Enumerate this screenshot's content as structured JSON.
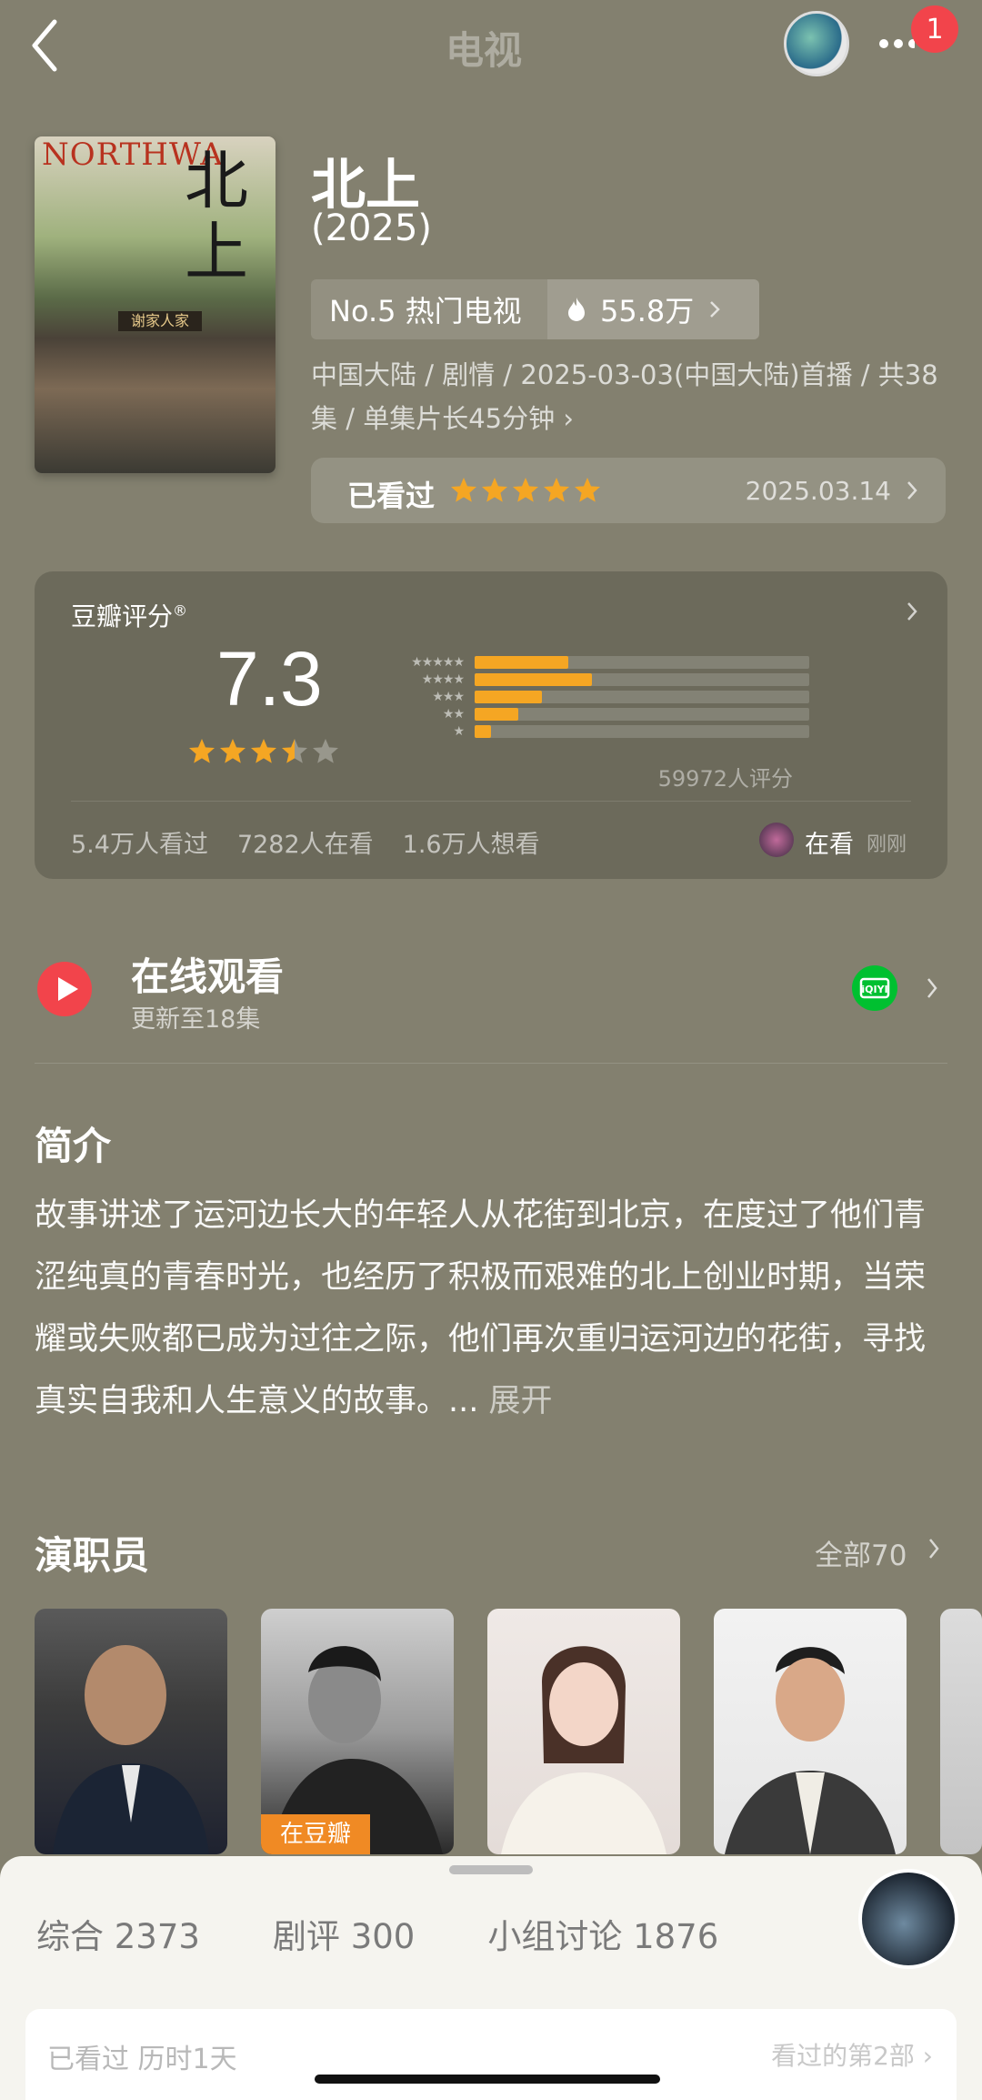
{
  "header": {
    "title": "电视",
    "notification_count": "1"
  },
  "poster": {
    "title_en": "NORTHWA",
    "title_cn": "北上",
    "sign_text": "谢家人家"
  },
  "show": {
    "title": "北上",
    "year": "(2025)",
    "rank": "No.5 热门电视",
    "heat": "55.8万",
    "meta": "中国大陆 / 剧情 / 2025-03-03(中国大陆)首播 / 共38集 / 单集片长45分钟",
    "meta_chevron": "›"
  },
  "watched": {
    "label": "已看过",
    "stars": 5,
    "date": "2025.03.14"
  },
  "rating": {
    "label": "豆瓣评分",
    "trademark": "®",
    "score": "7.3",
    "stars_value": 3.5,
    "distribution": [
      {
        "stars": "★★★★★",
        "percent": 28
      },
      {
        "stars": "★★★★",
        "percent": 35
      },
      {
        "stars": "★★★",
        "percent": 20
      },
      {
        "stars": "★★",
        "percent": 13
      },
      {
        "stars": "★",
        "percent": 5
      }
    ],
    "votes": "59972人评分",
    "stats": {
      "watched": "5.4万人看过",
      "watching": "7282人在看",
      "wish": "1.6万人想看"
    },
    "now_label": "在看",
    "now_time": "刚刚"
  },
  "watch_online": {
    "title": "在线观看",
    "subtitle": "更新至18集",
    "platform_icon": "iqiyi-icon"
  },
  "intro": {
    "title": "简介",
    "text": "故事讲述了运河边长大的年轻人从花街到北京，在度过了他们青涩纯真的青春时光，也经历了积极而艰难的北上创业时期，当荣耀或失败都已成为过往之际，他们再次重归运河边的花街，寻找真实自我和人生意义的故事。... ",
    "expand": "展开"
  },
  "cast": {
    "title": "演职员",
    "all_label": "全部70",
    "tag": "在豆瓣",
    "cards": [
      "cast-card-1",
      "cast-card-2",
      "cast-card-3",
      "cast-card-4"
    ]
  },
  "sheet": {
    "tabs": [
      {
        "label": "综合 2373"
      },
      {
        "label": "剧评 300"
      },
      {
        "label": "小组讨论 1876"
      }
    ],
    "card_left": "已看过  历时1天",
    "card_right": "看过的第2部  ›"
  },
  "colors": {
    "background": "#83806f",
    "star": "#f5a623",
    "play": "#f2444b",
    "iqiyi": "#00c030"
  }
}
